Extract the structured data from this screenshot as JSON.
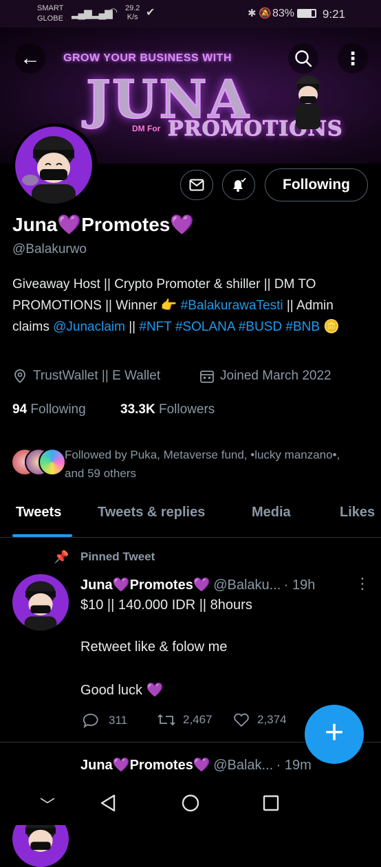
{
  "status_bar": {
    "carrier_line1": "SMART",
    "carrier_line2": "GLOBE",
    "speed_value": "29.2",
    "speed_unit": "K/s",
    "battery": "83%",
    "time": "9:21"
  },
  "banner": {
    "line1": "GROW YOUR BUSINESS WITH",
    "brand": "JUNA",
    "dm_for": "DM For",
    "promotions": "PROMOTIONS"
  },
  "profile": {
    "follow_button": "Following",
    "display_name": "Juna💜Promotes💜",
    "handle": "@Balakurwo",
    "bio_part1": "Giveaway Host || Crypto Promoter & shiller || DM TO PROMOTIONS || Winner 👉 ",
    "bio_tag1": "#BalakurawaTesti",
    "bio_part2": " || Admin claims ",
    "bio_mention": "@Junaclaim",
    "bio_part3": " || ",
    "bio_tag2": "#NFT",
    "bio_tag3": "#SOLANA",
    "bio_tag4": "#BUSD",
    "bio_tag5": "#BNB",
    "bio_end": " 🪙",
    "location": "TrustWallet || E Wallet",
    "joined": "Joined March 2022",
    "following_count": "94",
    "following_label": "Following",
    "followers_count": "33.3K",
    "followers_label": "Followers",
    "followed_by": "Followed by Puka, Metaverse fund, •lucky manzano•, and 59 others"
  },
  "tabs": [
    "Tweets",
    "Tweets & replies",
    "Media",
    "Likes"
  ],
  "tweets": [
    {
      "pinned_label": "Pinned Tweet",
      "name": "Juna💜Promotes💜",
      "handle": "@Balaku...",
      "time": "· 19h",
      "line1": "$10 || 140.000 IDR || 8hours",
      "line2": "Retweet like & folow me",
      "line3": "Good luck 💜",
      "replies": "311",
      "retweets": "2,467",
      "likes": "2,374"
    },
    {
      "name": "Juna💜Promotes💜",
      "handle": "@Balak...",
      "time": "· 19m"
    }
  ],
  "colors": {
    "accent": "#1d9bf0",
    "background": "#000000",
    "muted": "#8b98a5"
  }
}
